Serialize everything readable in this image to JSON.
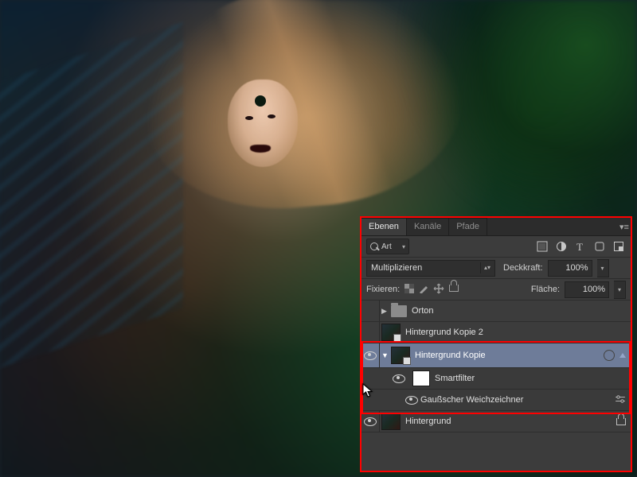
{
  "tabs": {
    "layers": "Ebenen",
    "channels": "Kanäle",
    "paths": "Pfade"
  },
  "search": {
    "label": "Art"
  },
  "blend": {
    "mode": "Multiplizieren"
  },
  "opacity": {
    "label": "Deckkraft:",
    "value": "100%"
  },
  "fill": {
    "label": "Fläche:",
    "value": "100%"
  },
  "lock": {
    "label": "Fixieren:"
  },
  "layers_list": [
    {
      "name": "Orton"
    },
    {
      "name": "Hintergrund Kopie 2"
    },
    {
      "name": "Hintergrund Kopie"
    },
    {
      "name": "Smartfilter"
    },
    {
      "name": "Gaußscher Weichzeichner"
    },
    {
      "name": "Hintergrund"
    }
  ]
}
